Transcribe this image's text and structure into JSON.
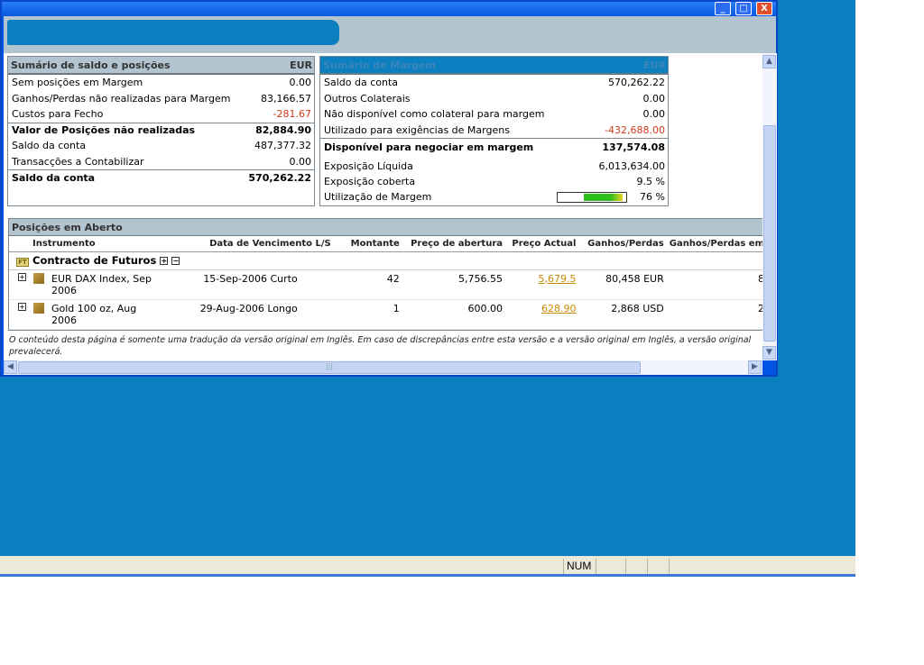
{
  "window": {
    "minimize": "_",
    "maximize": "□",
    "close": "X"
  },
  "balance": {
    "title": "Sumário de saldo e posições",
    "currency": "EUR",
    "rows": [
      {
        "label": "Sem posições em Margem",
        "value": "0.00"
      },
      {
        "label": "Ganhos/Perdas não realizadas para Margem",
        "value": "83,166.57"
      },
      {
        "label": "Custos para Fecho",
        "value": "-281.67"
      },
      {
        "label": "Valor de Posições não realizadas",
        "value": "82,884.90"
      },
      {
        "label": "Saldo da conta",
        "value": "487,377.32"
      },
      {
        "label": "Transacções a Contabilizar",
        "value": "0.00"
      },
      {
        "label": "Saldo da conta",
        "value": "570,262.22"
      }
    ]
  },
  "margin": {
    "title": "Sumário de Margem",
    "currency": "EUR",
    "rows": [
      {
        "label": "Saldo da conta",
        "value": "570,262.22"
      },
      {
        "label": "Outros Colaterais",
        "value": "0.00"
      },
      {
        "label": "Não disponível como colateral para margem",
        "value": "0.00"
      },
      {
        "label": "Utilizado para exigências de Margens",
        "value": "-432,688.00"
      },
      {
        "label": "Disponível para negociar em margem",
        "value": "137,574.08"
      },
      {
        "label": "Exposição Líquida",
        "value": "6,013,634.00"
      },
      {
        "label": "Exposição coberta",
        "value": "9.5 %"
      },
      {
        "label": "Utilização de Margem",
        "value": "76 %",
        "fill_percent": 76
      }
    ]
  },
  "positions": {
    "title": "Posições em Aberto",
    "columns": [
      "Instrumento",
      "Data de Vencimento L/S",
      "Montante",
      "Preço de abertura",
      "Preço Actual",
      "Ganhos/Perdas",
      "Ganhos/Perdas em"
    ],
    "group": {
      "icon_text": "FT",
      "label": "Contracto de Futuros",
      "expand": "+",
      "collapse": "−"
    },
    "rows": [
      {
        "instrument": "EUR DAX Index, Sep 2006",
        "expiry": "15-Sep-2006 Curto",
        "amount": "42",
        "open": "5,756.55",
        "current": "5,679.5",
        "pl": "80,458 EUR",
        "pl2": "8"
      },
      {
        "instrument": "Gold 100 oz, Aug 2006",
        "expiry": "29-Aug-2006 Longo",
        "amount": "1",
        "open": "600.00",
        "current": "628.90",
        "pl": "2,868 USD",
        "pl2": "2"
      }
    ]
  },
  "disclaimer": "O conteúdo desta página é somente uma tradução da versão original em Inglês. Em caso de discrepâncias entre esta versão e a versão original em Inglês, a versão original prevalecerá.",
  "statusbar": {
    "num": "NUM"
  },
  "colors": {
    "desktop": "#0a7fc0",
    "header": "#b1c4cf",
    "negative": "#d0381b",
    "link": "#c68a00"
  }
}
